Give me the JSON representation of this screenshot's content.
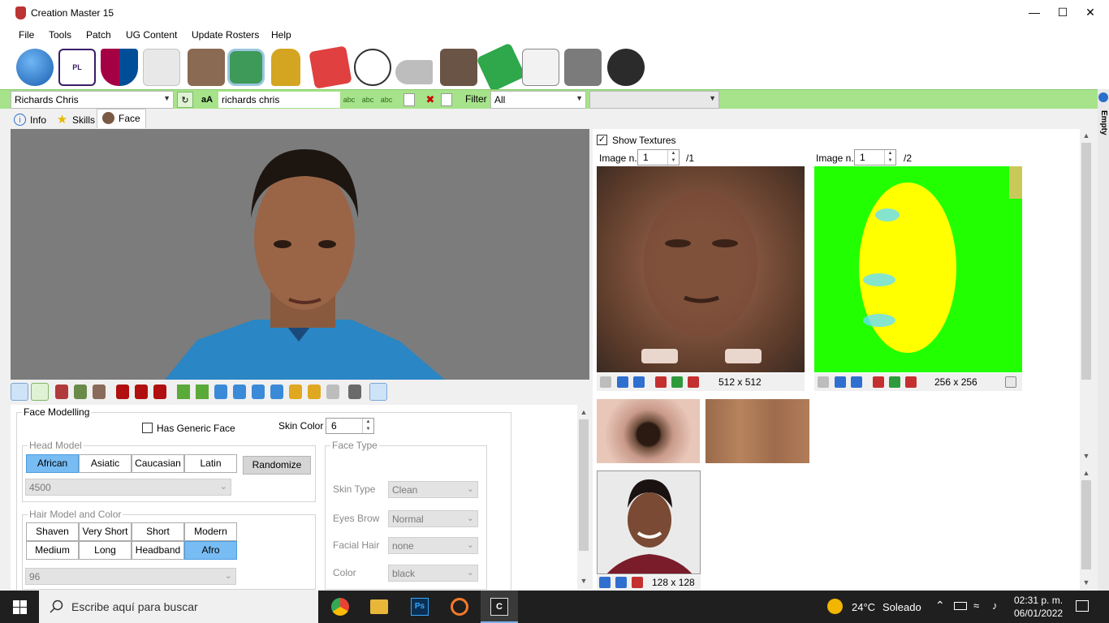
{
  "window": {
    "title": "Creation Master 15"
  },
  "menu": [
    "File",
    "Tools",
    "Patch",
    "UG Content",
    "Update Rosters",
    "Help"
  ],
  "toolbar_icons": [
    "globe-icon",
    "premier-league-icon",
    "barcelona-crest-icon",
    "kit-icon",
    "player-icon",
    "stadium-icon",
    "trophy-icon",
    "cards-icon",
    "ball-icon",
    "boots-icon",
    "manager-icon",
    "pitch-icon",
    "newspaper-icon",
    "gloves-icon",
    "headphones-icon"
  ],
  "search": {
    "player_select": "Richards Chris",
    "name_field": "richards chris",
    "filter_label": "Filter",
    "filter_value": "All",
    "extra_select": ""
  },
  "tabs": [
    "Info",
    "Skills",
    "Face"
  ],
  "side_tab": "Empty",
  "face_modelling": {
    "title": "Face Modelling",
    "has_generic_face": "Has Generic Face",
    "skin_color_label": "Skin Color",
    "skin_color_value": "6",
    "head_model": {
      "title": "Head Model",
      "options": [
        "African",
        "Asiatic",
        "Caucasian",
        "Latin"
      ],
      "selected": "African",
      "randomize": "Randomize",
      "model_id": "4500"
    },
    "hair": {
      "title": "Hair Model and Color",
      "options_row1": [
        "Shaven",
        "Very Short",
        "Short",
        "Modern"
      ],
      "options_row2": [
        "Medium",
        "Long",
        "Headband",
        "Afro"
      ],
      "selected": "Afro",
      "model_id": "96"
    },
    "face_type": {
      "title": "Face Type",
      "skin_type_label": "Skin Type",
      "skin_type": "Clean",
      "eyes_brow_label": "Eyes Brow",
      "eyes_brow": "Normal",
      "facial_hair_label": "Facial Hair",
      "facial_hair": "none",
      "color_label": "Color",
      "color": "black"
    }
  },
  "textures": {
    "show_textures": "Show Textures",
    "image_label": "Image n.",
    "left": {
      "value": "1",
      "total": "/1",
      "size": "512 x 512"
    },
    "right": {
      "value": "1",
      "total": "/2",
      "size": "256 x 256"
    },
    "portrait_size": "128 x 128"
  },
  "taskbar": {
    "search_placeholder": "Escribe aquí para buscar",
    "weather_temp": "24°C",
    "weather_text": "Soleado",
    "time": "02:31 p. m.",
    "date": "06/01/2022"
  },
  "colors": {
    "accent_green": "#a6e38a",
    "selected_blue": "#78bcf4"
  }
}
